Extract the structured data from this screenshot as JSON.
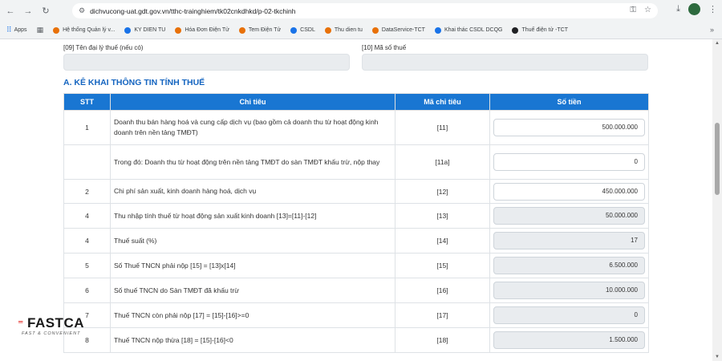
{
  "browser": {
    "url": "dichvucong-uat.gdt.gov.vn/tthc-trainghiem/tk02cnkdhkd/p-02-tkchinh",
    "apps_label": "Apps",
    "bookmarks": [
      {
        "label": "Hệ thống Quản lý v...",
        "color": "#e8710a"
      },
      {
        "label": "KY DIEN TU",
        "color": "#1a73e8"
      },
      {
        "label": "Hóa Đơn Điện Tử",
        "color": "#e8710a"
      },
      {
        "label": "Tem Điện Tử",
        "color": "#e8710a"
      },
      {
        "label": "CSDL",
        "color": "#1a73e8"
      },
      {
        "label": "Thu dien tu",
        "color": "#e8710a"
      },
      {
        "label": "DataService-TCT",
        "color": "#e8710a"
      },
      {
        "label": "Khai thác CSDL DCQG",
        "color": "#1a73e8"
      },
      {
        "label": "Thuế điện tử -TCT",
        "color": "#202124"
      }
    ],
    "more_bookmarks": "»"
  },
  "form": {
    "agent_name_label": "[09] Tên đại lý thuế (nếu có)",
    "agent_tax_code_label": "[10] Mã số thuế",
    "section_title": "A. KÊ KHAI THÔNG TIN TÍNH THUẾ",
    "columns": [
      "STT",
      "Chỉ tiêu",
      "Mã chỉ tiêu",
      "Số tiền"
    ],
    "rows": [
      {
        "stt": "1",
        "desc": "Doanh thu bán hàng hoá và cung cấp dịch vụ (bao gồm cả doanh thu từ hoạt động kinh doanh trên nền tảng TMĐT)",
        "code": "[11]",
        "amount": "500.000.000",
        "readonly": false,
        "height": 43
      },
      {
        "stt": "",
        "desc": "Trong đó: Doanh thu từ hoạt động trên nền tảng TMĐT do sàn TMĐT khấu trừ, nộp thay",
        "code": "[11a]",
        "amount": "0",
        "readonly": false,
        "height": 43
      },
      {
        "stt": "2",
        "desc": "Chi phí sản xuất, kinh doanh hàng hoá, dịch vụ",
        "code": "[12]",
        "amount": "450.000.000",
        "readonly": false,
        "height": 30
      },
      {
        "stt": "4",
        "desc": "Thu nhập tính thuế từ hoạt động sản xuất kinh doanh [13]=[11]-[12]",
        "code": "[13]",
        "amount": "50.000.000",
        "readonly": true,
        "height": 31
      },
      {
        "stt": "4",
        "desc": "Thuế suất (%)",
        "code": "[14]",
        "amount": "17",
        "readonly": true,
        "height": 31
      },
      {
        "stt": "5",
        "desc": "Số Thuế TNCN phải nộp [15] = [13]x[14]",
        "code": "[15]",
        "amount": "6.500.000",
        "readonly": true,
        "height": 31
      },
      {
        "stt": "6",
        "desc": "Số thuế TNCN do Sàn TMĐT đã khấu trừ",
        "code": "[16]",
        "amount": "10.000.000",
        "readonly": true,
        "height": 31
      },
      {
        "stt": "7",
        "desc": "Thuế TNCN còn phải nộp [17] = [15]-[16]>=0",
        "code": "[17]",
        "amount": "0",
        "readonly": true,
        "height": 31
      },
      {
        "stt": "8",
        "desc": "Thuế TNCN nộp thừa [18] = [15]-[16]<0",
        "code": "[18]",
        "amount": "1.500.000",
        "readonly": true,
        "height": 31
      }
    ]
  },
  "logo": {
    "name": "FASTCA",
    "tagline": "FAST & CONVENIENT"
  },
  "colors": {
    "header_blue": "#1976d2",
    "title_blue": "#1565c0",
    "logo_red": "#e53935"
  }
}
